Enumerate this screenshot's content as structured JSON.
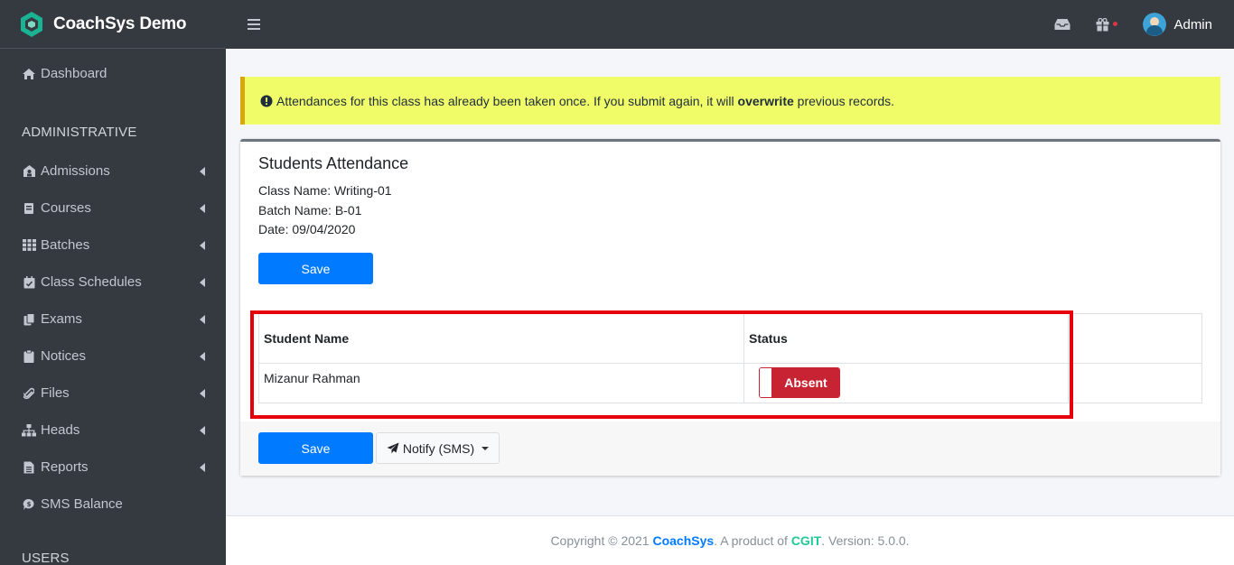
{
  "app": {
    "brand": "CoachSys Demo"
  },
  "sidebar": {
    "dashboard": "Dashboard",
    "section_admin": "ADMINISTRATIVE",
    "items": [
      {
        "label": "Admissions",
        "icon": "user-building-icon"
      },
      {
        "label": "Courses",
        "icon": "book-icon"
      },
      {
        "label": "Batches",
        "icon": "grid-icon"
      },
      {
        "label": "Class Schedules",
        "icon": "calendar-check-icon"
      },
      {
        "label": "Exams",
        "icon": "copy-icon"
      },
      {
        "label": "Notices",
        "icon": "clipboard-icon"
      },
      {
        "label": "Files",
        "icon": "paperclip-icon"
      },
      {
        "label": "Heads",
        "icon": "sitemap-icon"
      },
      {
        "label": "Reports",
        "icon": "file-alt-icon"
      }
    ],
    "sms_balance": "SMS Balance",
    "section_users": "USERS"
  },
  "topbar": {
    "user_name": "Admin"
  },
  "alert": {
    "text_before": "Attendances for this class has already been taken once. If you submit again, it will ",
    "text_bold": "overwrite",
    "text_after": " previous records."
  },
  "card": {
    "title": "Students Attendance",
    "class_name": "Class Name: Writing-01",
    "batch_name": "Batch Name: B-01",
    "date": "Date: 09/04/2020",
    "save_label": "Save",
    "table": {
      "headers": [
        "Student Name",
        "Status"
      ],
      "rows": [
        {
          "name": "Mizanur Rahman",
          "status": "Absent"
        }
      ]
    },
    "footer_save_label": "Save",
    "notify_label": "Notify (SMS)"
  },
  "footer": {
    "prefix": "Copyright © 2021 ",
    "brand": "CoachSys",
    "middle": ". A product of ",
    "company": "CGIT",
    "suffix": ". Version: 5.0.0."
  },
  "colors": {
    "sidebar_bg": "#343a40",
    "primary": "#007bff",
    "danger": "#c82333",
    "alert_bg": "#f0fc68",
    "highlight": "#e5000b"
  }
}
